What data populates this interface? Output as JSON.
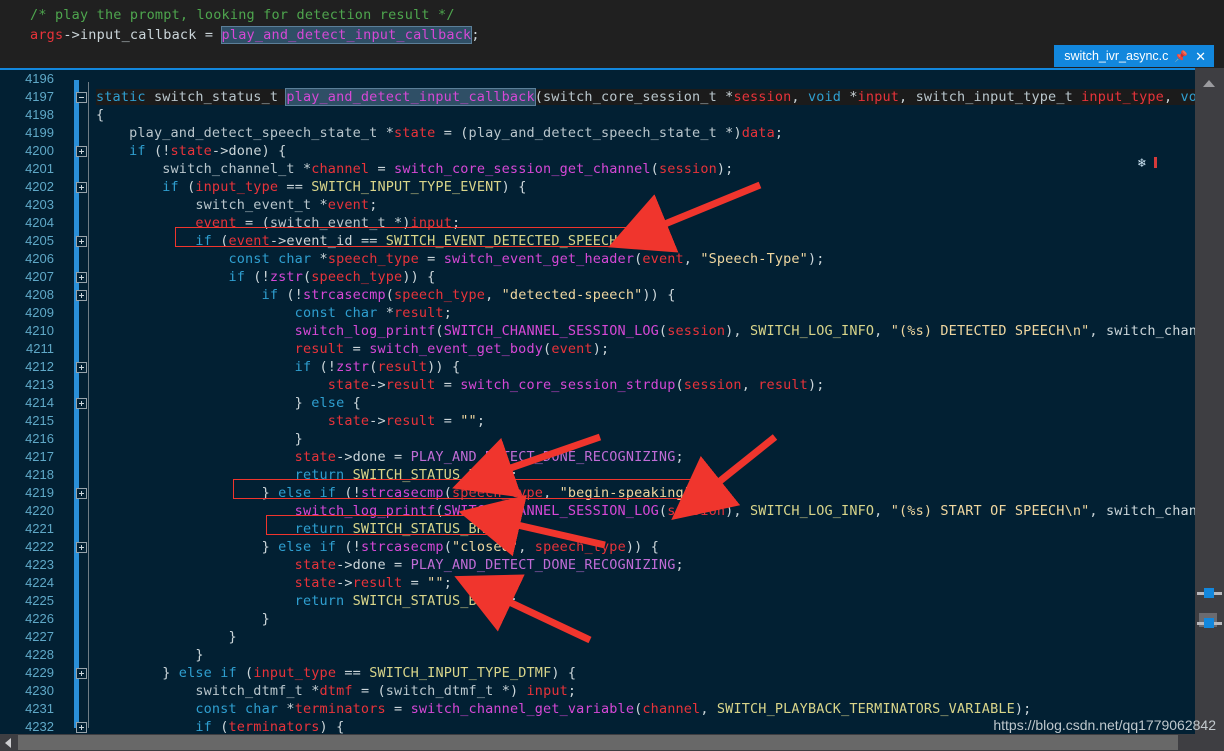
{
  "app": {
    "kind": "code-editor",
    "colors": {
      "editor_bg": "#022033",
      "preview_bg": "#202020",
      "tab_bg": "#1287dd",
      "annotation": "#f0352d",
      "change_bar": "#2a8fd8",
      "line_number": "#5fa8c7"
    }
  },
  "tab": {
    "label": "switch_ivr_async.c",
    "pin_icon": "pin-icon",
    "close_icon": "close-icon"
  },
  "preview": {
    "lines": [
      "/* play the prompt, looking for detection result */",
      "args->input_callback = play_and_detect_input_callback;"
    ],
    "selected_token": "play_and_detect_input_callback"
  },
  "watermark": "https://blog.csdn.net/qq1779062842",
  "scrollbar": {
    "up_arrow_icon": "chevron-up-icon",
    "left_arrow_icon": "chevron-left-icon",
    "marker_count": 2
  },
  "editor": {
    "first_line": 4196,
    "last_line": 4232,
    "lines": [
      {
        "n": 4196,
        "fold": null,
        "text": ""
      },
      {
        "n": 4197,
        "fold": "minus",
        "text": "static switch_status_t play_and_detect_input_callback(switch_core_session_t *session, void *input, switch_input_type_t input_type, void *"
      },
      {
        "n": 4198,
        "fold": null,
        "text": "{"
      },
      {
        "n": 4199,
        "fold": null,
        "text": "    play_and_detect_speech_state_t *state = (play_and_detect_speech_state_t *)data;"
      },
      {
        "n": 4200,
        "fold": "plus",
        "text": "    if (!state->done) {"
      },
      {
        "n": 4201,
        "fold": null,
        "text": "        switch_channel_t *channel = switch_core_session_get_channel(session);"
      },
      {
        "n": 4202,
        "fold": "plus",
        "text": "        if (input_type == SWITCH_INPUT_TYPE_EVENT) {"
      },
      {
        "n": 4203,
        "fold": null,
        "text": "            switch_event_t *event;"
      },
      {
        "n": 4204,
        "fold": null,
        "text": "            event = (switch_event_t *)input;"
      },
      {
        "n": 4205,
        "fold": "plus",
        "text": "            if (event->event_id == SWITCH_EVENT_DETECTED_SPEECH) {"
      },
      {
        "n": 4206,
        "fold": null,
        "text": "                const char *speech_type = switch_event_get_header(event, \"Speech-Type\");"
      },
      {
        "n": 4207,
        "fold": "plus",
        "text": "                if (!zstr(speech_type)) {"
      },
      {
        "n": 4208,
        "fold": "plus",
        "text": "                    if (!strcasecmp(speech_type, \"detected-speech\")) {"
      },
      {
        "n": 4209,
        "fold": null,
        "text": "                        const char *result;"
      },
      {
        "n": 4210,
        "fold": null,
        "text": "                        switch_log_printf(SWITCH_CHANNEL_SESSION_LOG(session), SWITCH_LOG_INFO, \"(%s) DETECTED SPEECH\\n\", switch_channel_"
      },
      {
        "n": 4211,
        "fold": null,
        "text": "                        result = switch_event_get_body(event);"
      },
      {
        "n": 4212,
        "fold": "plus",
        "text": "                        if (!zstr(result)) {"
      },
      {
        "n": 4213,
        "fold": null,
        "text": "                            state->result = switch_core_session_strdup(session, result);"
      },
      {
        "n": 4214,
        "fold": "plus",
        "text": "                        } else {"
      },
      {
        "n": 4215,
        "fold": null,
        "text": "                            state->result = \"\";"
      },
      {
        "n": 4216,
        "fold": null,
        "text": "                        }"
      },
      {
        "n": 4217,
        "fold": null,
        "text": "                        state->done = PLAY_AND_DETECT_DONE_RECOGNIZING;"
      },
      {
        "n": 4218,
        "fold": null,
        "text": "                        return SWITCH_STATUS_BREAK;"
      },
      {
        "n": 4219,
        "fold": "plus",
        "text": "                    } else if (!strcasecmp(speech_type, \"begin-speaking\")) {"
      },
      {
        "n": 4220,
        "fold": null,
        "text": "                        switch_log_printf(SWITCH_CHANNEL_SESSION_LOG(session), SWITCH_LOG_INFO, \"(%s) START OF SPEECH\\n\", switch_channel_"
      },
      {
        "n": 4221,
        "fold": null,
        "text": "                        return SWITCH_STATUS_BREAK;"
      },
      {
        "n": 4222,
        "fold": "plus",
        "text": "                    } else if (!strcasecmp(\"closed\", speech_type)) {"
      },
      {
        "n": 4223,
        "fold": null,
        "text": "                        state->done = PLAY_AND_DETECT_DONE_RECOGNIZING;"
      },
      {
        "n": 4224,
        "fold": null,
        "text": "                        state->result = \"\";"
      },
      {
        "n": 4225,
        "fold": null,
        "text": "                        return SWITCH_STATUS_BREAK;"
      },
      {
        "n": 4226,
        "fold": null,
        "text": "                    }"
      },
      {
        "n": 4227,
        "fold": null,
        "text": "                }"
      },
      {
        "n": 4228,
        "fold": null,
        "text": "            }"
      },
      {
        "n": 4229,
        "fold": "plus",
        "text": "        } else if (input_type == SWITCH_INPUT_TYPE_DTMF) {"
      },
      {
        "n": 4230,
        "fold": null,
        "text": "            switch_dtmf_t *dtmf = (switch_dtmf_t *) input;"
      },
      {
        "n": 4231,
        "fold": null,
        "text": "            const char *terminators = switch_channel_get_variable(channel, SWITCH_PLAYBACK_TERMINATORS_VARIABLE);"
      },
      {
        "n": 4232,
        "fold": "plus",
        "text": "            if (terminators) {"
      }
    ],
    "annotations": {
      "boxes": [
        {
          "name": "highlight-box-detected-speech",
          "line": 4205,
          "label": "if (event->event_id == SWITCH_EVENT_DETECTED_SPEECH) {"
        },
        {
          "name": "highlight-box-begin-speaking",
          "line": 4219,
          "label": "} else if (!strcasecmp(speech_type, \"begin-speaking\")) {"
        },
        {
          "name": "highlight-box-return-break",
          "line": 4221,
          "label": "return SWITCH_STATUS_BREAK;"
        }
      ],
      "arrows": [
        {
          "name": "arrow-to-detected-speech",
          "target_line": 4205
        },
        {
          "name": "arrow-to-return-break-4218",
          "target_line": 4218
        },
        {
          "name": "arrow-to-begin-speaking",
          "target_line": 4219
        },
        {
          "name": "arrow-to-return-break-4221",
          "target_line": 4221
        },
        {
          "name": "arrow-to-return-break-4225",
          "target_line": 4225
        }
      ]
    }
  }
}
